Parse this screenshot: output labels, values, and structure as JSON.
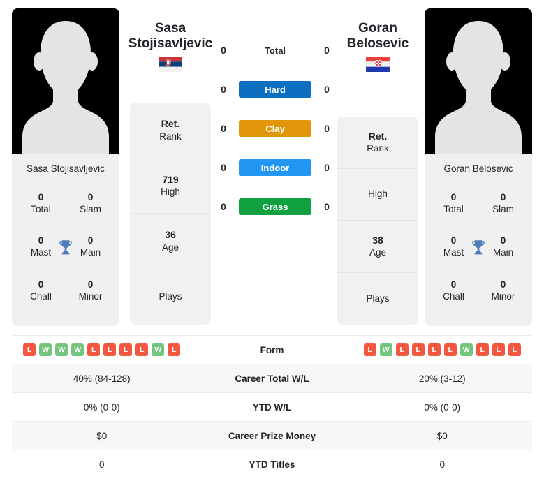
{
  "players": {
    "left": {
      "first_name": "Sasa",
      "last_name": "Stojisavljevic",
      "full_name": "Sasa Stojisavljevic",
      "flag": "serbia-flag",
      "rank": "Ret.",
      "rank_label": "Rank",
      "high": "719",
      "high_label": "High",
      "age": "36",
      "age_label": "Age",
      "plays": "",
      "plays_label": "Plays",
      "titles": {
        "total": "0",
        "total_label": "Total",
        "slam": "0",
        "slam_label": "Slam",
        "mast": "0",
        "mast_label": "Mast",
        "main": "0",
        "main_label": "Main",
        "chall": "0",
        "chall_label": "Chall",
        "minor": "0",
        "minor_label": "Minor"
      },
      "h2h": {
        "total": "0",
        "hard": "0",
        "clay": "0",
        "indoor": "0",
        "grass": "0"
      },
      "form": [
        "L",
        "W",
        "W",
        "W",
        "L",
        "L",
        "L",
        "L",
        "W",
        "L"
      ],
      "career_total_wl": "40% (84-128)",
      "ytd_wl": "0% (0-0)",
      "career_prize_money": "$0",
      "ytd_titles": "0"
    },
    "right": {
      "first_name": "Goran",
      "last_name": "Belosevic",
      "full_name": "Goran Belosevic",
      "flag": "croatia-flag",
      "rank": "Ret.",
      "rank_label": "Rank",
      "high": "",
      "high_label": "High",
      "age": "38",
      "age_label": "Age",
      "plays": "",
      "plays_label": "Plays",
      "titles": {
        "total": "0",
        "total_label": "Total",
        "slam": "0",
        "slam_label": "Slam",
        "mast": "0",
        "mast_label": "Mast",
        "main": "0",
        "main_label": "Main",
        "chall": "0",
        "chall_label": "Chall",
        "minor": "0",
        "minor_label": "Minor"
      },
      "h2h": {
        "total": "0",
        "hard": "0",
        "clay": "0",
        "indoor": "0",
        "grass": "0"
      },
      "form": [
        "L",
        "W",
        "L",
        "L",
        "L",
        "L",
        "W",
        "L",
        "L",
        "L"
      ],
      "career_total_wl": "20% (3-12)",
      "ytd_wl": "0% (0-0)",
      "career_prize_money": "$0",
      "ytd_titles": "0"
    }
  },
  "surfaces": [
    {
      "key": "total",
      "label": "Total",
      "color": ""
    },
    {
      "key": "hard",
      "label": "Hard",
      "color": "#0c6fc0"
    },
    {
      "key": "clay",
      "label": "Clay",
      "color": "#e2960b"
    },
    {
      "key": "indoor",
      "label": "Indoor",
      "color": "#2196f3"
    },
    {
      "key": "grass",
      "label": "Grass",
      "color": "#10a03f"
    }
  ],
  "table_rows": [
    {
      "label": "Form"
    },
    {
      "label": "Career Total W/L"
    },
    {
      "label": "YTD W/L"
    },
    {
      "label": "Career Prize Money"
    },
    {
      "label": "YTD Titles"
    }
  ],
  "colors": {
    "win_badge": "#74c47d",
    "loss_badge": "#f4573f",
    "trophy": "#4a7ebb",
    "card_bg": "#f0f0f0"
  }
}
